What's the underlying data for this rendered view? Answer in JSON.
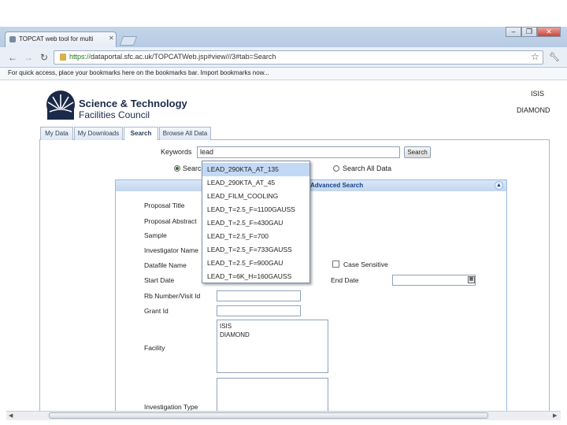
{
  "browser": {
    "tab_title": "TOPCAT web tool for multi",
    "url_secure": "https://",
    "url_rest": "dataportal.sfc.ac.uk/TOPCATWeb.jsp#view///3#tab=Search",
    "bookmarks_bar_text": "For quick access, place your bookmarks here on the bookmarks bar. Import bookmarks now...",
    "minimize": "–",
    "restore": "❐",
    "close": "✕"
  },
  "header": {
    "org_line1": "Science & Technology",
    "org_line2": "Facilities Council",
    "facility_links": [
      "ISIS",
      "DIAMOND"
    ]
  },
  "tabs": [
    "My Data",
    "My Downloads",
    "Search",
    "Browse All Data"
  ],
  "search": {
    "keywords_label": "Keywords",
    "keywords_value": "lead",
    "search_button": "Search",
    "radio_my_label": "Search My Data",
    "radio_all_label": "Search All Data",
    "advanced_panel_title": "Advanced Search"
  },
  "autocomplete": [
    "LEAD_290KTA_AT_135",
    "LEAD_290KTA_AT_45",
    "LEAD_FILM_COOLING",
    "LEAD_T=2.5_F=1100GAUSS",
    "LEAD_T=2.5_F=430GAU",
    "LEAD_T=2.5_F=700",
    "LEAD_T=2.5_F=733GAUSS",
    "LEAD_T=2.5_F=900GAU",
    "LEAD_T=6K_H=160GAUSS"
  ],
  "form": {
    "proposal_title": "Proposal Title",
    "proposal_abstract": "Proposal Abstract",
    "sample": "Sample",
    "investigator_name": "Investigator Name",
    "datafile_name": "Datafile Name",
    "case_sensitive": "Case Sensitive",
    "start_date": "Start Date",
    "end_date": "End Date",
    "rb_number": "Rb Number/Visit Id",
    "grant_id": "Grant Id",
    "facility": "Facility",
    "facility_options": [
      "ISIS",
      "DIAMOND"
    ],
    "investigation_type": "Investigation Type"
  },
  "colors": {
    "panel_header": "#c3d6ee",
    "selection": "#c2d9f6",
    "brand_navy": "#1b2a4a"
  }
}
